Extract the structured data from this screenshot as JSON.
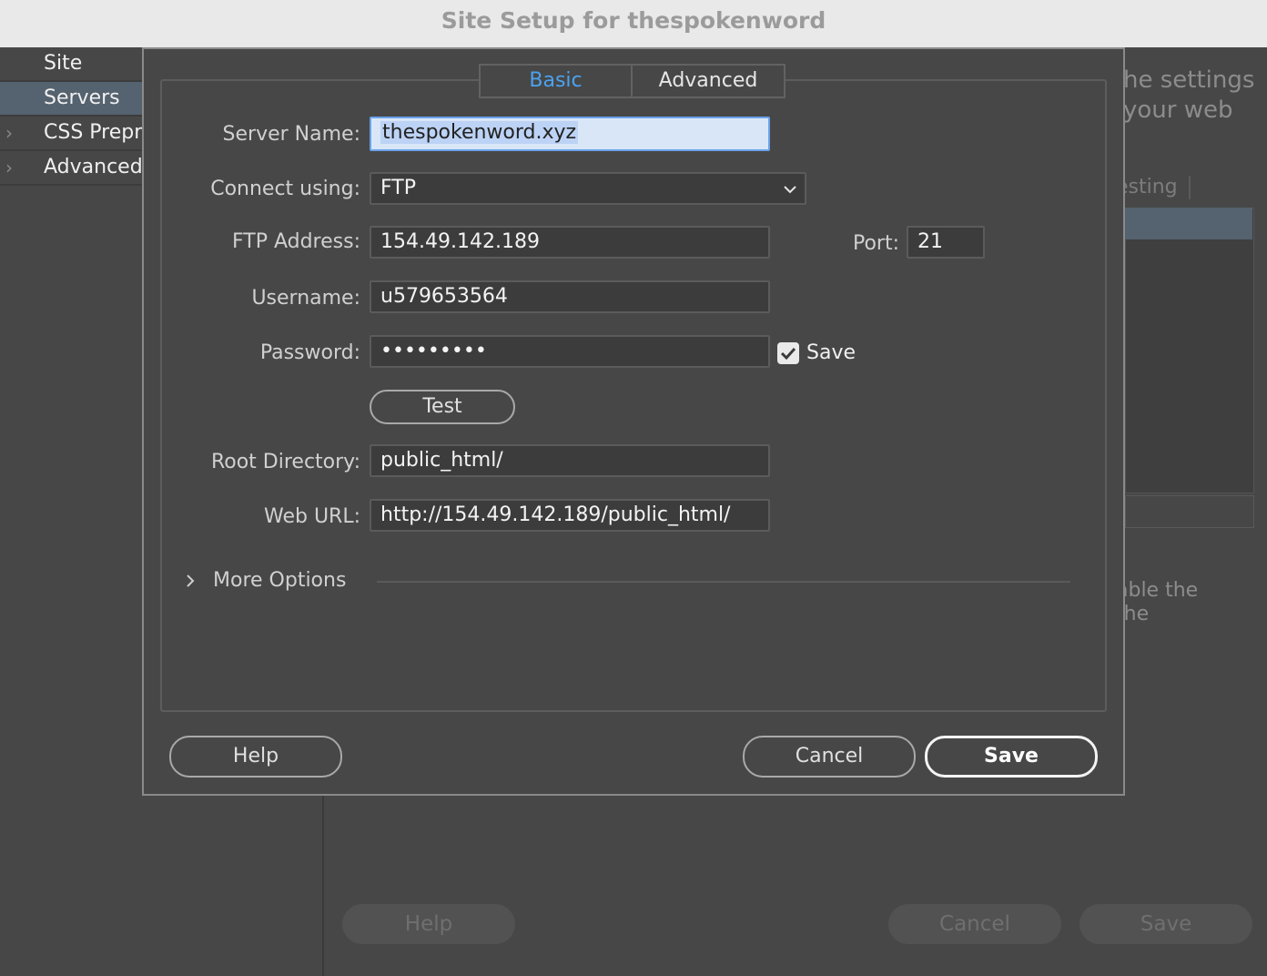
{
  "window": {
    "title": "Site Setup for thespokenword"
  },
  "background": {
    "sidebar": [
      {
        "label": "Site",
        "selected": false,
        "chevron": false
      },
      {
        "label": "Servers",
        "selected": true,
        "chevron": false
      },
      {
        "label": "CSS Prepro",
        "selected": false,
        "chevron": true
      },
      {
        "label": "Advanced",
        "selected": false,
        "chevron": true
      }
    ],
    "text_fragment_1": "he settings\nyour web",
    "text_fragment_2": "esting",
    "text_fragment_3": "able the\nthe",
    "buttons": {
      "help": "Help",
      "cancel": "Cancel",
      "save": "Save"
    }
  },
  "dialog": {
    "tabs": [
      {
        "label": "Basic",
        "active": true
      },
      {
        "label": "Advanced",
        "active": false
      }
    ],
    "server_name": {
      "label": "Server Name:",
      "value": "thespokenword.xyz"
    },
    "connect_using": {
      "label": "Connect using:",
      "value": "FTP"
    },
    "ftp_address": {
      "label": "FTP Address:",
      "value": "154.49.142.189"
    },
    "port": {
      "label": "Port:",
      "value": "21"
    },
    "username": {
      "label": "Username:",
      "value": "u579653564"
    },
    "password": {
      "label": "Password:",
      "value": "•••••••••"
    },
    "save_password": {
      "label": "Save",
      "checked": true
    },
    "test_button": "Test",
    "root_directory": {
      "label": "Root Directory:",
      "value": "public_html/"
    },
    "web_url": {
      "label": "Web URL:",
      "value": "http://154.49.142.189/public_html/"
    },
    "more_options": "More Options",
    "buttons": {
      "help": "Help",
      "cancel": "Cancel",
      "save": "Save"
    }
  },
  "colors": {
    "active_tab": "#4aa3f0",
    "selection": "#55626f",
    "background": "#474747"
  }
}
